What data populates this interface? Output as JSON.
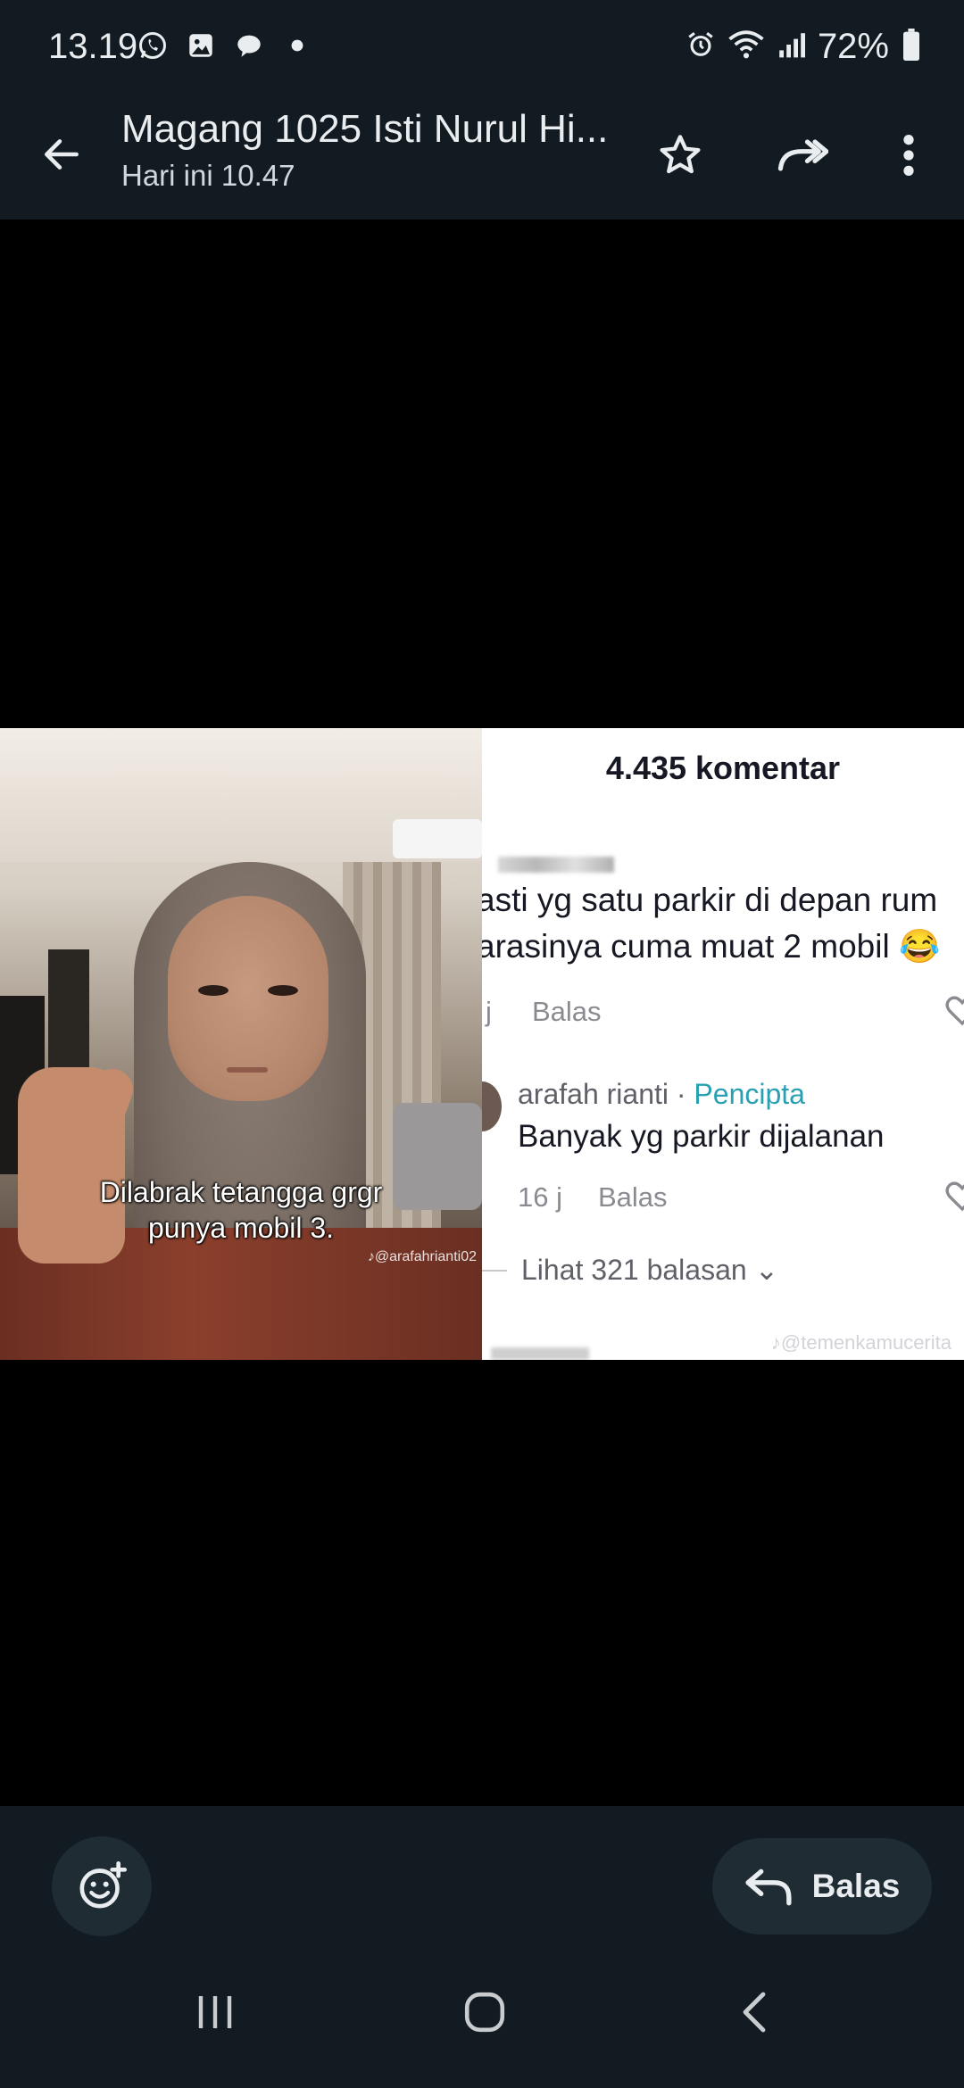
{
  "status_bar": {
    "time": "13.19",
    "battery": "72%",
    "left_icons": [
      "whatsapp-icon",
      "gallery-icon",
      "chat-bubble-icon",
      "dot-icon"
    ],
    "right_icons": [
      "alarm-icon",
      "wifi-icon",
      "signal-icon",
      "battery-icon"
    ]
  },
  "header": {
    "title": "Magang 1025 Isti Nurul Hi...",
    "subtitle": "Hari ini 10.47",
    "icons": [
      "back-arrow-icon",
      "star-icon",
      "forward-icon",
      "more-vert-icon"
    ]
  },
  "media": {
    "left_panel": {
      "caption_line1": "Dilabrak tetangga grgr",
      "caption_line2": "punya mobil 3.",
      "watermark": "@arafahrianti02"
    },
    "right_panel": {
      "comments_count": "4.435 komentar",
      "comment1_line1": "asti yg satu parkir di depan rum",
      "comment1_line2": "arasinya cuma muat 2 mobil 😂",
      "comment1_time": "j",
      "comment1_reply": "Balas",
      "author_name": "arafah rianti",
      "author_sep": " · ",
      "author_tag": "Pencipta",
      "author_comment": "Banyak yg parkir dijalanan",
      "author_time": "16 j",
      "author_reply": "Balas",
      "view_replies": "Lihat 321 balasan ⌄",
      "watermark": "@temenkamucerita"
    }
  },
  "footer": {
    "reply_label": "Balas",
    "icons": [
      "add-reaction-icon",
      "reply-icon"
    ]
  },
  "navbar": {
    "icons": [
      "recent-apps-icon",
      "home-icon",
      "back-nav-icon"
    ]
  },
  "colors": {
    "bar_bg": "#111b21",
    "button_bg": "#1f2c33",
    "text_primary": "#e9edef",
    "creator_tag": "#2aa1b3"
  }
}
